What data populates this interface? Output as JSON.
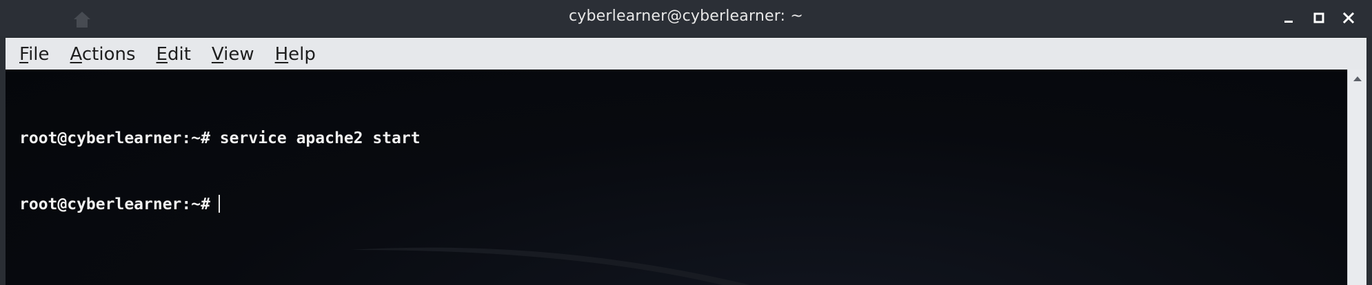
{
  "window": {
    "title": "cyberlearner@cyberlearner: ~"
  },
  "menubar": {
    "items": [
      {
        "label": "File",
        "mnemonic": "F",
        "rest": "ile"
      },
      {
        "label": "Actions",
        "mnemonic": "A",
        "rest": "ctions"
      },
      {
        "label": "Edit",
        "mnemonic": "E",
        "rest": "dit"
      },
      {
        "label": "View",
        "mnemonic": "V",
        "rest": "iew"
      },
      {
        "label": "Help",
        "mnemonic": "H",
        "rest": "elp"
      }
    ]
  },
  "terminal": {
    "lines": [
      {
        "prompt": "root@cyberlearner:~#",
        "command": " service apache2 start"
      },
      {
        "prompt": "root@cyberlearner:~#",
        "command": ""
      }
    ]
  },
  "icons": {
    "minimize": "minimize-icon",
    "maximize": "maximize-icon",
    "close": "close-icon",
    "scroll_up": "arrow-up-icon"
  },
  "colors": {
    "titlebar": "#2b2f36",
    "menubar": "#e6e8eb",
    "terminal_bg": "#080a0f",
    "terminal_fg": "#f2f2f2"
  }
}
